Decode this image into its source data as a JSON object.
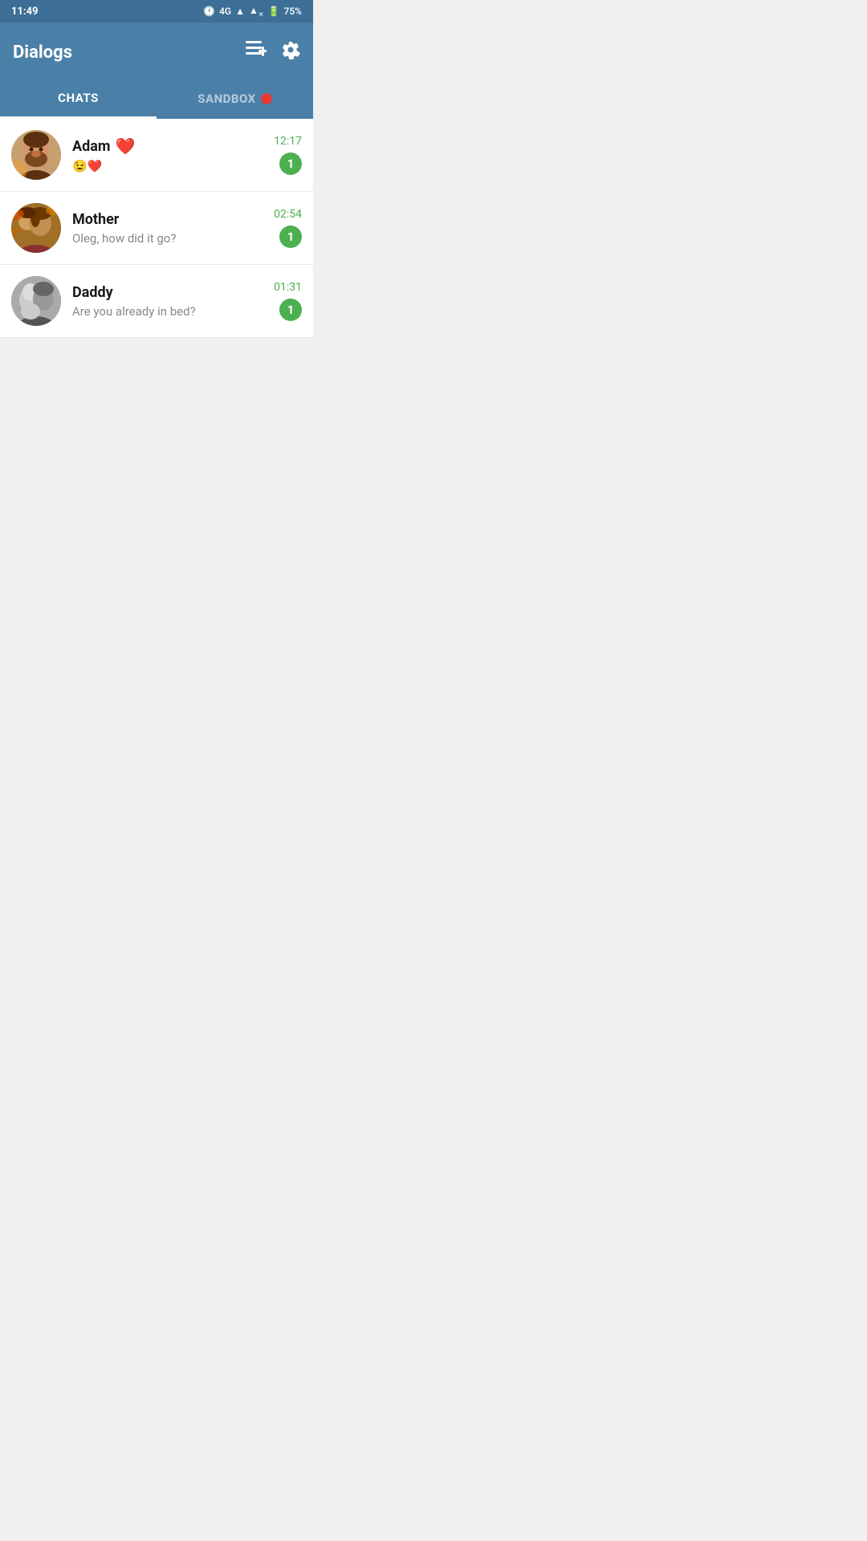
{
  "statusBar": {
    "time": "11:49",
    "signal": "4G",
    "battery": "75%"
  },
  "header": {
    "title": "Dialogs",
    "composeLabel": "≡+",
    "settingsLabel": "⚙"
  },
  "tabs": [
    {
      "id": "chats",
      "label": "CHATS",
      "active": true,
      "badge": false
    },
    {
      "id": "sandbox",
      "label": "SANDBOX",
      "active": false,
      "badge": true
    }
  ],
  "chats": [
    {
      "id": "adam",
      "name": "Adam",
      "nameEmoji": "❤️",
      "preview": "😉❤️",
      "time": "12:17",
      "unread": 1
    },
    {
      "id": "mother",
      "name": "Mother",
      "preview": "Oleg, how did it go?",
      "time": "02:54",
      "unread": 1
    },
    {
      "id": "daddy",
      "name": "Daddy",
      "preview": "Are you already in bed?",
      "time": "01:31",
      "unread": 1
    }
  ],
  "colors": {
    "headerBg": "#4a7fa8",
    "activeTabUnderline": "#ffffff",
    "unreadBadge": "#4caf50",
    "timeText": "#4caf50",
    "sandboxDot": "#e53935"
  }
}
